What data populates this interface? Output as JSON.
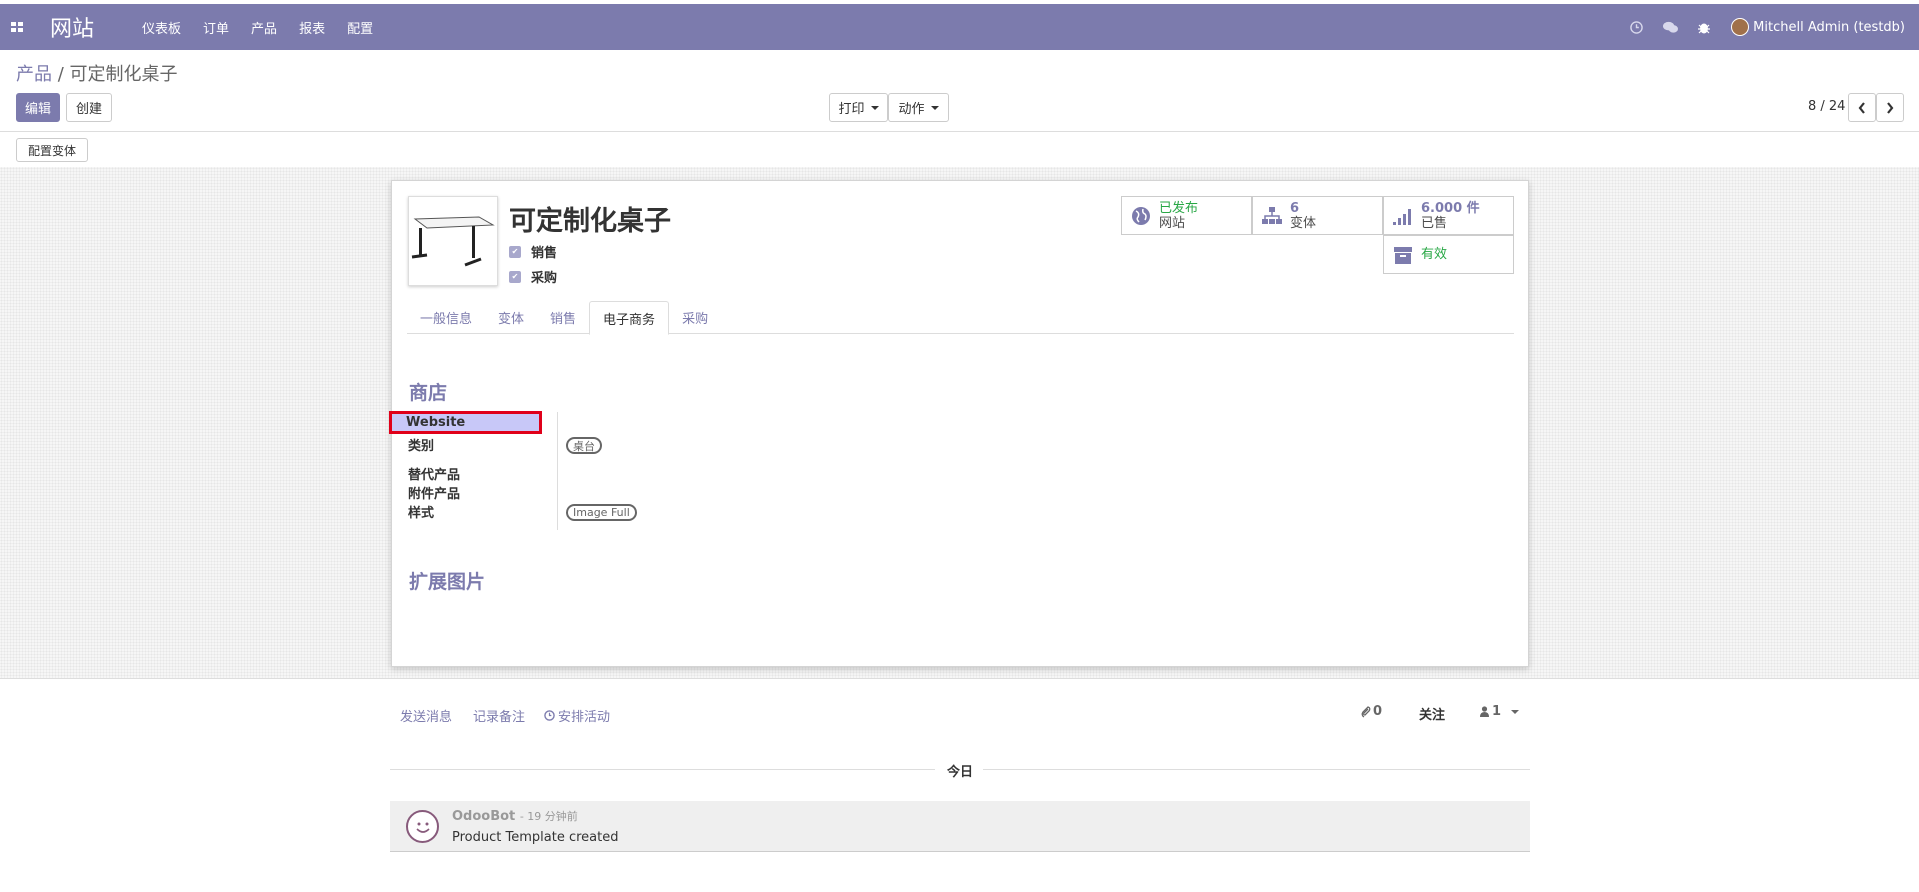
{
  "navbar": {
    "app_title": "网站",
    "menu": [
      "仪表板",
      "订单",
      "产品",
      "报表",
      "配置"
    ],
    "user": "Mitchell Admin (testdb)"
  },
  "breadcrumb": {
    "parent": "产品",
    "separator": "/",
    "current": "可定制化桌子"
  },
  "toolbar": {
    "edit": "编辑",
    "create": "创建",
    "print": "打印",
    "action": "动作",
    "pager": "8 / 24",
    "configure_variants": "配置变体"
  },
  "product": {
    "name": "可定制化桌子",
    "can_be_sold": "销售",
    "can_be_purchased": "采购"
  },
  "smart_buttons": {
    "website": {
      "top": "已发布",
      "bottom": "网站"
    },
    "variants": {
      "top": "6",
      "bottom": "变体"
    },
    "sold": {
      "top": "6.000 件",
      "bottom": "已售"
    },
    "active": {
      "label": "有效"
    }
  },
  "tabs": [
    "一般信息",
    "变体",
    "销售",
    "电子商务",
    "采购"
  ],
  "active_tab": "电子商务",
  "ecommerce": {
    "shop_title": "商店",
    "fields": {
      "website": "Website",
      "category": "类别",
      "alternative": "替代产品",
      "accessory": "附件产品",
      "style": "样式"
    },
    "category_tag": "桌台",
    "style_tag": "Image Full",
    "extra_images_title": "扩展图片"
  },
  "chatter": {
    "send_message": "发送消息",
    "log_note": "记录备注",
    "schedule_activity": "安排活动",
    "attachments": "0",
    "follow": "关注",
    "followers": "1",
    "today": "今日",
    "message": {
      "author": "OdooBot",
      "time": "- 19 分钟前",
      "body": "Product Template created"
    }
  },
  "colors": {
    "brand": "#7c7bad",
    "success": "#28a745",
    "highlight_border": "#e0001a"
  }
}
